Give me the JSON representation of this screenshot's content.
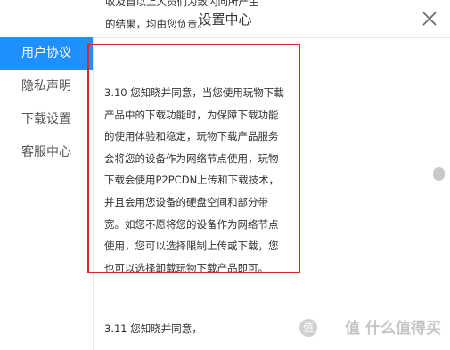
{
  "window": {
    "title": "设置中心",
    "close_icon": "close-icon"
  },
  "sidebar": {
    "items": [
      {
        "label": "用户协议",
        "active": true
      },
      {
        "label": "隐私声明",
        "active": false
      },
      {
        "label": "下载设置",
        "active": false
      },
      {
        "label": "客服中心",
        "active": false
      }
    ]
  },
  "content": {
    "top_text": "收及自以上人员们为致闪问所产生\n的结果，均由您负责。",
    "clause_310": "3.10 您知晓并同意，当您使用玩物下載\n产品中的下载功能时，为保障下载功能\n的使用体验和稳定，玩物下载产品服务\n会将您的设备作为网络节点使用，玩物\n下载会使用P2PCDN上传和下载技术，\n并且会用您设备的硬盘空间和部分带\n宽。如您不愿将您的设备作为网络节点\n使用，您可以选择限制上传或下载，您\n也可以选择卸载玩物下载产品即可。",
    "clause_311": "3.11 您知晓并同意，"
  },
  "watermark": {
    "text": "值 什么值得买"
  },
  "colors": {
    "accent": "#1e90ff",
    "highlight_border": "#d9292b"
  }
}
